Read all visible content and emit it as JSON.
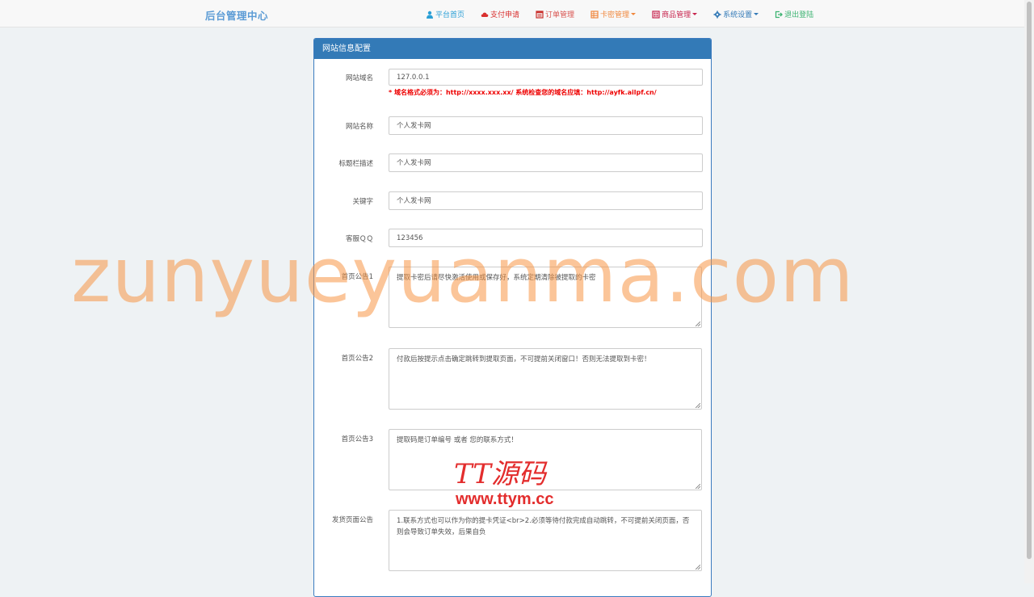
{
  "navbar": {
    "brand": "后台管理中心",
    "items": [
      {
        "label": "平台首页",
        "icon": "user-icon",
        "color": "#2a9fd6",
        "dropdown": false
      },
      {
        "label": "支付申请",
        "icon": "cloud-icon",
        "color": "#d9302f",
        "dropdown": false
      },
      {
        "label": "订单管理",
        "icon": "list-icon",
        "color": "#d9534f",
        "dropdown": false
      },
      {
        "label": "卡密管理",
        "icon": "table-icon",
        "color": "#f0883e",
        "dropdown": true
      },
      {
        "label": "商品管理",
        "icon": "grid-icon",
        "color": "#c7254e",
        "dropdown": true
      },
      {
        "label": "系统设置",
        "icon": "gear-icon",
        "color": "#337ab7",
        "dropdown": true
      },
      {
        "label": "退出登陆",
        "icon": "logout-icon",
        "color": "#3cb371",
        "dropdown": false
      }
    ]
  },
  "panel": {
    "title": "网站信息配置",
    "fields": {
      "domain": {
        "label": "网站域名",
        "value": "127.0.0.1",
        "help": "* 域名格式必须为：http://xxxx.xxx.xx/ 系统检查您的域名应填：http://ayfk.ailpf.cn/"
      },
      "site_name": {
        "label": "网站名称",
        "value": "个人发卡网"
      },
      "title_desc": {
        "label": "标题栏描述",
        "value": "个人发卡网"
      },
      "keywords": {
        "label": "关键字",
        "value": "个人发卡网"
      },
      "qq": {
        "label": "客服ＱＱ",
        "value": "123456"
      },
      "notice1": {
        "label": "首页公告1",
        "value": "提取卡密后请尽快激活使用或保存好，系统定期清除被提取的卡密"
      },
      "notice2": {
        "label": "首页公告2",
        "value": "付款后按提示点击确定跳转到提取页面，不可提前关闭窗口！否则无法提取到卡密！"
      },
      "notice3": {
        "label": "首页公告3",
        "value": "提取码是订单编号 或者 您的联系方式！"
      },
      "ship_notice": {
        "label": "发货页面公告",
        "value": "1.联系方式也可以作为你的提卡凭证<br>2.必须等待付款完成自动跳转，不可提前关闭页面，否则会导致订单失效，后果自负"
      }
    }
  },
  "watermarks": {
    "main": "zunyueyuanma.com",
    "logo_line1": "TT源码",
    "logo_line2": "www.ttym.cc"
  }
}
